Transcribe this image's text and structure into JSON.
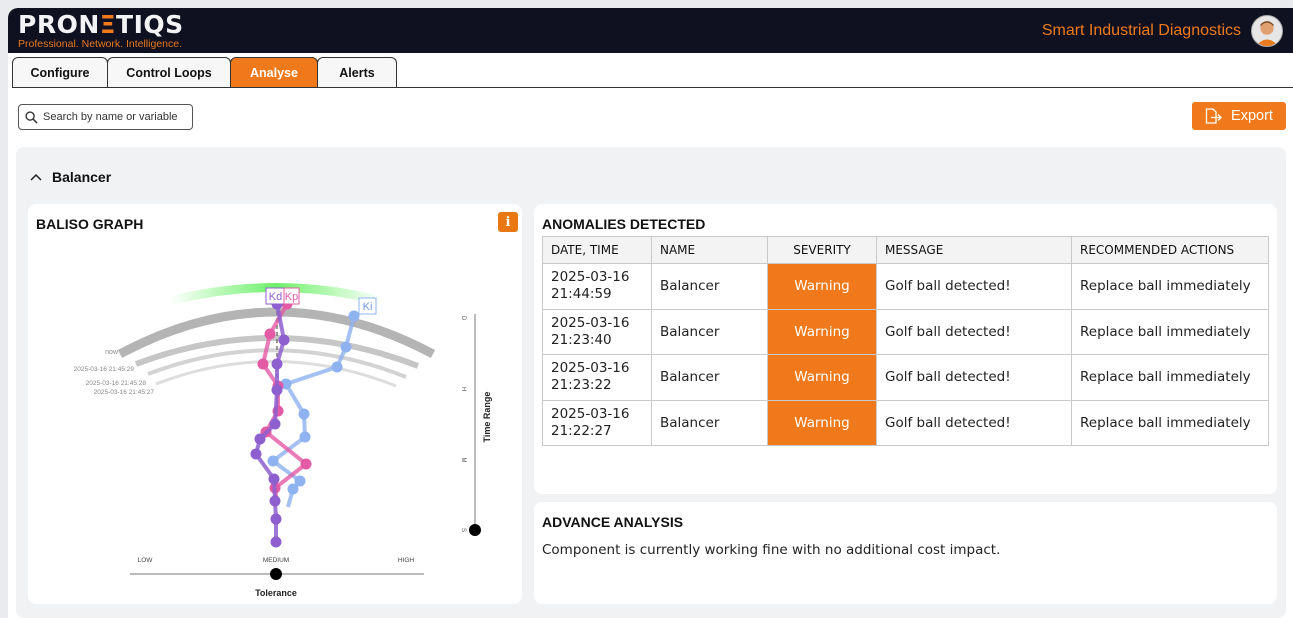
{
  "header": {
    "logo_prefix": "PRON",
    "logo_mid": "Ξ",
    "logo_suffix": "TIQS",
    "tagline": "Professional. Network. Intelligence.",
    "app_name": "Smart Industrial Diagnostics"
  },
  "tabs": [
    {
      "label": "Configure",
      "active": false
    },
    {
      "label": "Control Loops",
      "active": false
    },
    {
      "label": "Analyse",
      "active": true
    },
    {
      "label": "Alerts",
      "active": false
    }
  ],
  "toolbar": {
    "search_placeholder": "Search by name or variable",
    "export_label": "Export"
  },
  "section": {
    "title": "Balancer",
    "expanded": true
  },
  "baliso": {
    "title": "BALISO GRAPH",
    "info_label": "i",
    "arc_labels": [
      "now",
      "2025-03-16 21:45:29",
      "2025-03-16 21:45:28",
      "2025-03-16 21:45:27"
    ],
    "markers": [
      "Kd",
      "Kp",
      "Ki"
    ],
    "time_range_label": "Time Range",
    "time_ticks": [
      "D",
      "H",
      "M",
      "S"
    ],
    "time_range_value": "S",
    "tolerance_label": "Tolerance",
    "tolerance_levels": [
      "LOW",
      "MEDIUM",
      "HIGH"
    ],
    "tolerance_value": "MEDIUM",
    "colors": {
      "kd": "#8e5fcf",
      "kp": "#e35aa5",
      "ki": "#8fb2f0",
      "band": "#6ef06a",
      "arc": "#b4b4b4"
    }
  },
  "anomalies": {
    "title": "ANOMALIES DETECTED",
    "columns": [
      "DATE, TIME",
      "NAME",
      "SEVERITY",
      "MESSAGE",
      "RECOMMENDED ACTIONS"
    ],
    "rows": [
      {
        "date": "2025-03-16",
        "time": "21:44:59",
        "name": "Balancer",
        "severity": "Warning",
        "message": "Golf ball detected!",
        "action": "Replace ball immediately"
      },
      {
        "date": "2025-03-16",
        "time": "21:23:40",
        "name": "Balancer",
        "severity": "Warning",
        "message": "Golf ball detected!",
        "action": "Replace ball immediately"
      },
      {
        "date": "2025-03-16",
        "time": "21:23:22",
        "name": "Balancer",
        "severity": "Warning",
        "message": "Golf ball detected!",
        "action": "Replace ball immediately"
      },
      {
        "date": "2025-03-16",
        "time": "21:22:27",
        "name": "Balancer",
        "severity": "Warning",
        "message": "Golf ball detected!",
        "action": "Replace ball immediately"
      }
    ]
  },
  "advance": {
    "title": "ADVANCE ANALYSIS",
    "text": "Component is currently working fine with no additional cost impact."
  },
  "colors": {
    "accent": "#f07a1b",
    "header_bg": "#0f1020"
  }
}
